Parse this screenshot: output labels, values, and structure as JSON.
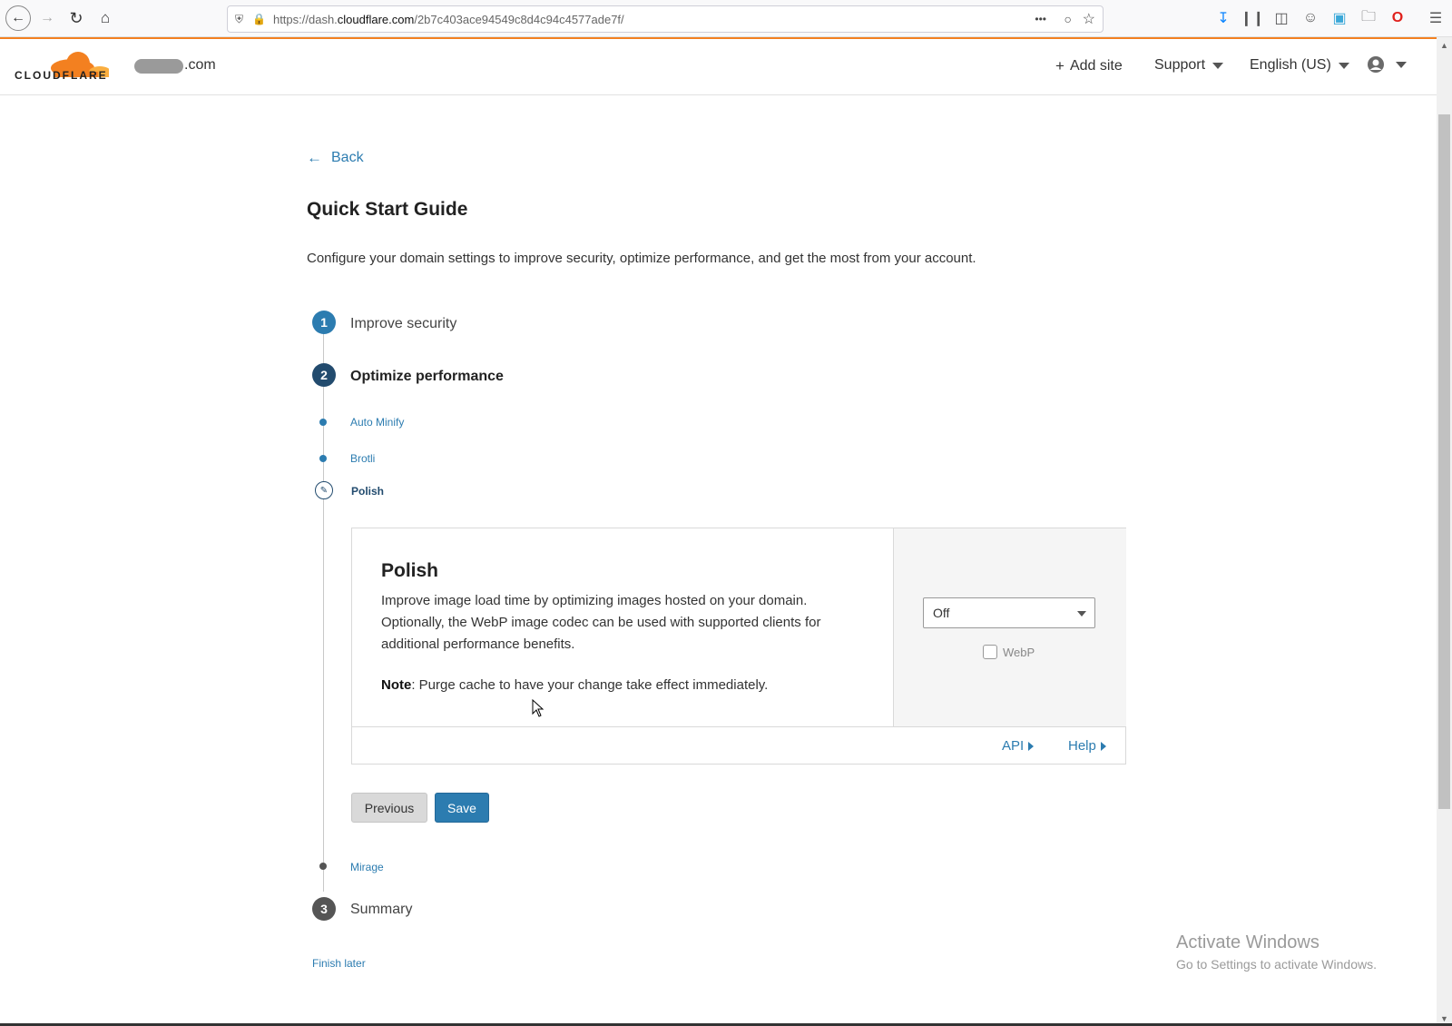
{
  "browser": {
    "url_prefix": "https://dash.",
    "url_domain": "cloudflare.com",
    "url_path": "/2b7c403ace94549c8d4c94c4577ade7f/",
    "overflow_label": "•••"
  },
  "header": {
    "logo_text": "CLOUDFLARE",
    "domain_suffix": ".com",
    "add_site": "Add site",
    "support": "Support",
    "language": "English (US)"
  },
  "back_label": "Back",
  "page": {
    "title": "Quick Start Guide",
    "description": "Configure your domain settings to improve security, optimize performance, and get the most from your account."
  },
  "steps": [
    {
      "number": "1",
      "label": "Improve security"
    },
    {
      "number": "2",
      "label": "Optimize performance"
    },
    {
      "number": "3",
      "label": "Summary"
    }
  ],
  "substeps": [
    "Auto Minify",
    "Brotli",
    "Polish",
    "Mirage"
  ],
  "card": {
    "title": "Polish",
    "description": "Improve image load time by optimizing images hosted on your domain. Optionally, the WebP image codec can be used with supported clients for additional performance benefits.",
    "note_label": "Note",
    "note_text": ": Purge cache to have your change take effect immediately.",
    "select_value": "Off",
    "webp_label": "WebP",
    "webp_checked": false,
    "api_link": "API",
    "help_link": "Help"
  },
  "buttons": {
    "previous": "Previous",
    "save": "Save"
  },
  "finish_later": "Finish later",
  "watermark": {
    "line1": "Activate Windows",
    "line2": "Go to Settings to activate Windows."
  },
  "colors": {
    "accent_blue": "#2c7cb0",
    "active_step": "#224b6e",
    "cloudflare_orange": "#f38020",
    "inactive_step": "#555555"
  }
}
